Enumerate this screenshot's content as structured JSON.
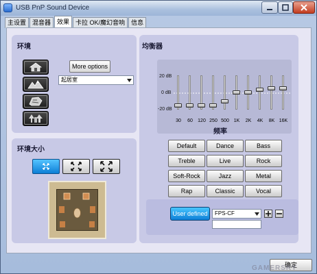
{
  "window": {
    "title": "USB PnP Sound Device",
    "controls": {
      "minimize_icon": "minimize-icon",
      "maximize_icon": "maximize-icon",
      "close_icon": "close-icon"
    }
  },
  "tabs": [
    {
      "label": "主设置",
      "active": false
    },
    {
      "label": "混音器",
      "active": false
    },
    {
      "label": "效果",
      "active": true
    },
    {
      "label": "卡拉 OK/魔幻音响",
      "active": false
    },
    {
      "label": "信息",
      "active": false
    }
  ],
  "environment": {
    "title": "环境",
    "buttons": [
      {
        "icon": "living-room-icon"
      },
      {
        "icon": "mountain-icon"
      },
      {
        "icon": "stone-icon"
      },
      {
        "icon": "forest-icon"
      }
    ],
    "more_options": "More options",
    "dropdown_value": "起居室"
  },
  "environment_size": {
    "title": "环境大小",
    "buttons": [
      {
        "icon": "small-room-arrows-icon",
        "selected": true
      },
      {
        "icon": "medium-room-arrows-icon",
        "selected": false
      },
      {
        "icon": "large-room-arrows-icon",
        "selected": false
      }
    ],
    "room_preview_icon": "room-preview-icon"
  },
  "equalizer": {
    "title": "均衡器",
    "axis_title": "频率",
    "db_labels": [
      "20 dB",
      "0 dB",
      "-20 dB"
    ],
    "db_range": [
      -20,
      20
    ],
    "bands": [
      {
        "freq": "30",
        "gain": -15
      },
      {
        "freq": "60",
        "gain": -15
      },
      {
        "freq": "120",
        "gain": -15
      },
      {
        "freq": "250",
        "gain": -15
      },
      {
        "freq": "500",
        "gain": -10
      },
      {
        "freq": "1K",
        "gain": 0
      },
      {
        "freq": "2K",
        "gain": 0
      },
      {
        "freq": "4K",
        "gain": 3
      },
      {
        "freq": "8K",
        "gain": 5
      },
      {
        "freq": "16K",
        "gain": 5
      }
    ],
    "presets": [
      "Default",
      "Dance",
      "Bass",
      "Treble",
      "Live",
      "Rock",
      "Soft-Rock",
      "Jazz",
      "Metal",
      "Rap",
      "Classic",
      "Vocal"
    ],
    "user_defined": "User defined",
    "user_dropdown_value": "FPS-CF",
    "user_name_value": ""
  },
  "footer": {
    "confirm_label": "确定",
    "watermark": "GAMERSKY"
  }
}
